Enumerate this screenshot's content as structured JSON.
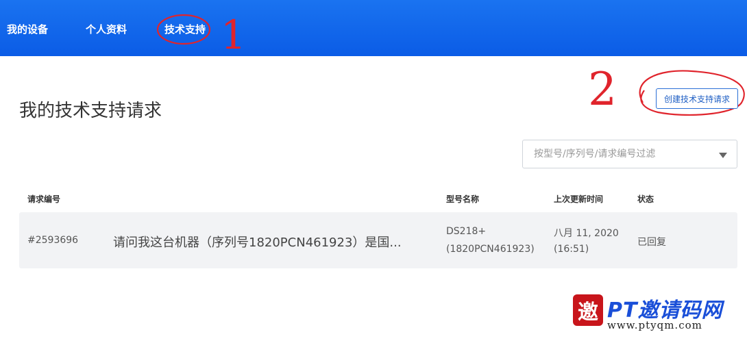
{
  "nav": {
    "items": [
      {
        "label": "我的设备"
      },
      {
        "label": "个人资料"
      },
      {
        "label": "技术支持"
      }
    ]
  },
  "annotations": {
    "step1": "1",
    "step2": "2",
    "ink_color": "#e0242c"
  },
  "page": {
    "title": "我的技术支持请求",
    "create_button": "创建技术支持请求"
  },
  "filter": {
    "placeholder": "按型号/序列号/请求编号过滤",
    "value": ""
  },
  "table": {
    "columns": [
      "请求编号",
      "型号名称",
      "上次更新时间",
      "状态"
    ],
    "rows": [
      {
        "id": "#2593696",
        "subject": "请问我这台机器（序列号1820PCN461923）是国...",
        "model": "DS218+",
        "serial": "(1820PCN461923)",
        "updated_date": "八月 11, 2020",
        "updated_time": "(16:51)",
        "status": "已回复"
      }
    ]
  },
  "watermark": {
    "seal": "邀",
    "title": "PT邀请码网",
    "url": "www.ptyqm.com"
  },
  "colors": {
    "topbar": "#0b5ce6",
    "accent": "#1f5fc4",
    "row_bg": "#f2f3f5"
  }
}
